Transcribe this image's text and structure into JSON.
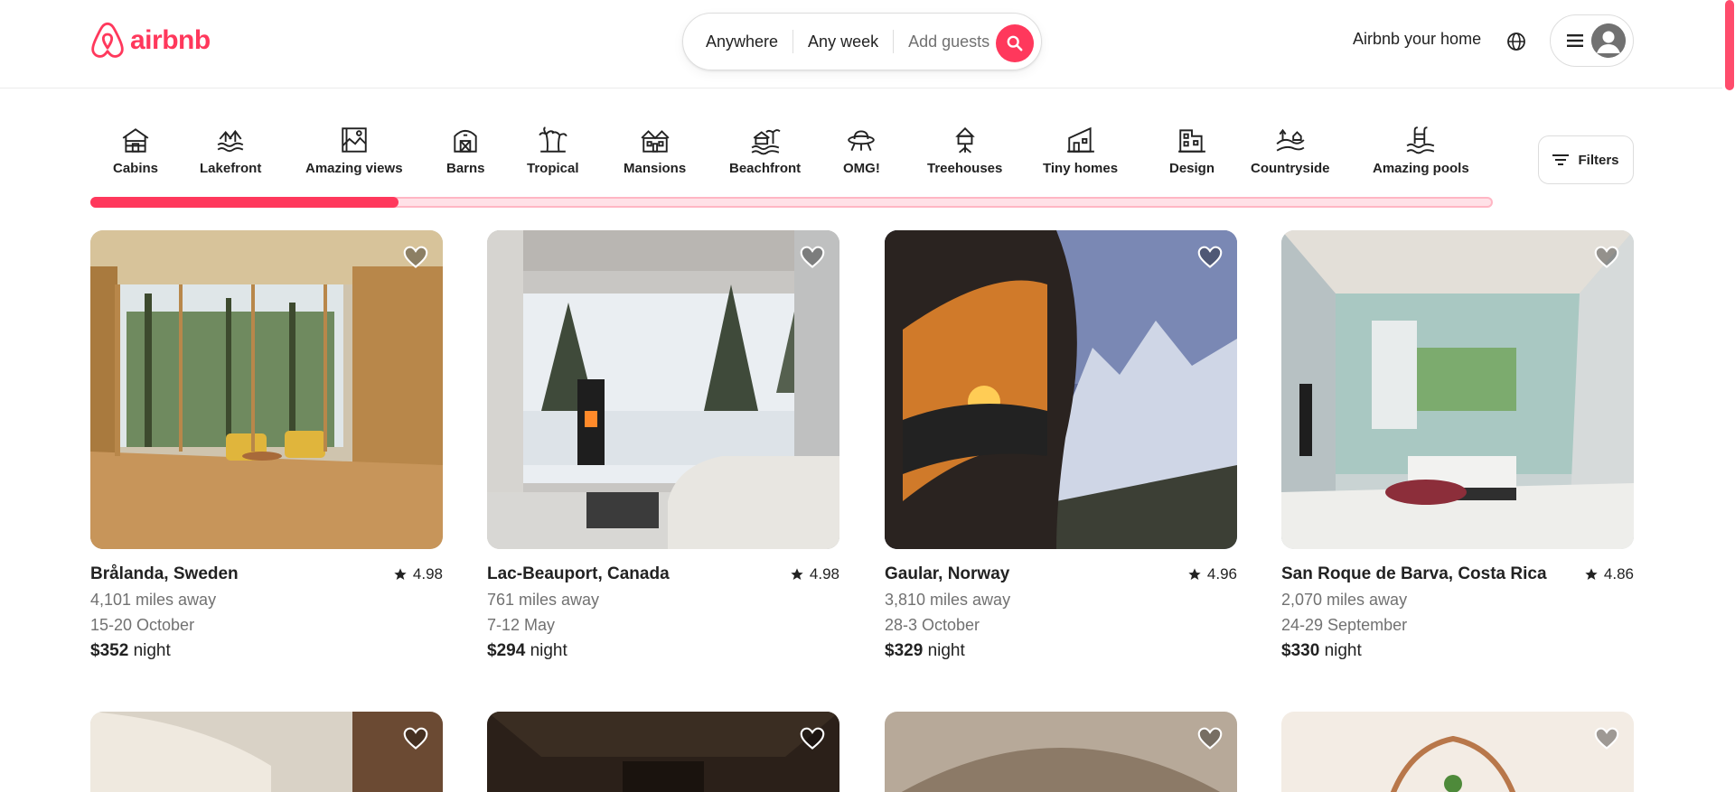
{
  "brand": {
    "name": "airbnb",
    "color": "#ff385c"
  },
  "search": {
    "location": "Anywhere",
    "dates": "Any week",
    "guests_placeholder": "Add guests"
  },
  "header": {
    "host_link": "Airbnb your home",
    "globe_icon": "globe-icon",
    "menu_icon": "hamburger-icon",
    "avatar_icon": "user-avatar-icon"
  },
  "categories": {
    "items": [
      {
        "label": "Cabins",
        "icon": "cabin-icon"
      },
      {
        "label": "Lakefront",
        "icon": "lakefront-icon"
      },
      {
        "label": "Amazing views",
        "icon": "amazing-views-icon"
      },
      {
        "label": "Barns",
        "icon": "barn-icon"
      },
      {
        "label": "Tropical",
        "icon": "tropical-icon"
      },
      {
        "label": "Mansions",
        "icon": "mansion-icon"
      },
      {
        "label": "Beachfront",
        "icon": "beachfront-icon"
      },
      {
        "label": "OMG!",
        "icon": "omg-icon"
      },
      {
        "label": "Treehouses",
        "icon": "treehouse-icon"
      },
      {
        "label": "Tiny homes",
        "icon": "tiny-home-icon"
      },
      {
        "label": "Design",
        "icon": "design-icon"
      },
      {
        "label": "Countryside",
        "icon": "countryside-icon"
      },
      {
        "label": "Amazing pools",
        "icon": "pool-icon"
      }
    ],
    "scroll_progress": 0.22,
    "filters_label": "Filters"
  },
  "listings": [
    {
      "title": "Brålanda, Sweden",
      "rating": "4.98",
      "distance": "4,101 miles away",
      "dates": "15-20 October",
      "price": "$352",
      "price_unit": "night"
    },
    {
      "title": "Lac-Beauport, Canada",
      "rating": "4.98",
      "distance": "761 miles away",
      "dates": "7-12 May",
      "price": "$294",
      "price_unit": "night"
    },
    {
      "title": "Gaular, Norway",
      "rating": "4.96",
      "distance": "3,810 miles away",
      "dates": "28-3 October",
      "price": "$329",
      "price_unit": "night"
    },
    {
      "title": "San Roque de Barva, Costa Rica",
      "rating": "4.86",
      "distance": "2,070 miles away",
      "dates": "24-29 September",
      "price": "$330",
      "price_unit": "night"
    }
  ]
}
